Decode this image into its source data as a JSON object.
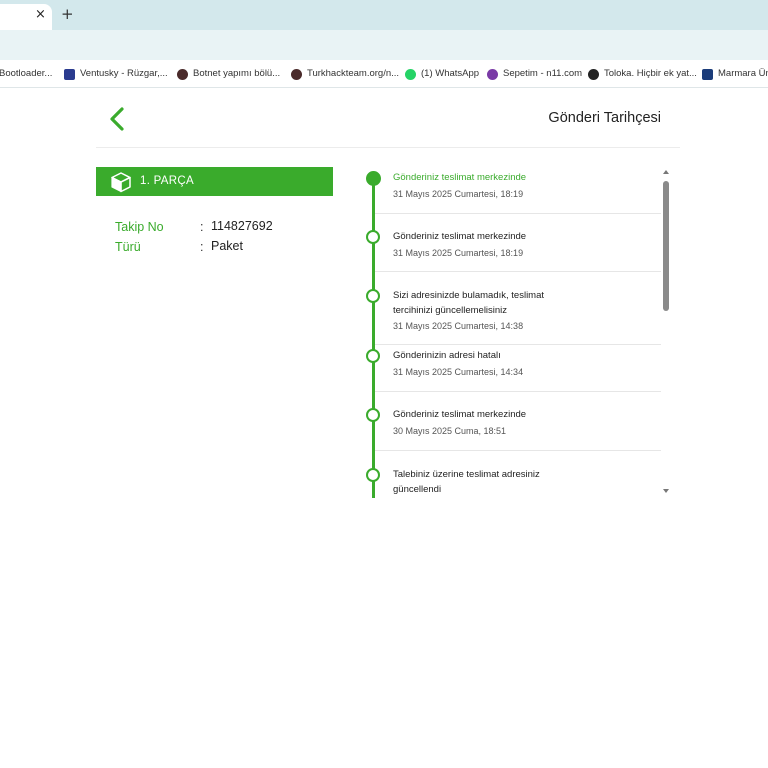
{
  "browser": {
    "close_tab": "×",
    "new_tab": "+",
    "bookmarks": [
      {
        "label": "Bootloader...",
        "icon": "bootloader-icon"
      },
      {
        "label": "Ventusky - Rüzgar,...",
        "icon": "ventusky-icon",
        "color": "#2a3b8f"
      },
      {
        "label": "Botnet yapımı bölü...",
        "icon": "turkhack-icon",
        "color": "#4a2a2a"
      },
      {
        "label": "Turkhackteam.org/n...",
        "icon": "turkhack-icon",
        "color": "#4a2a2a"
      },
      {
        "label": "(1) WhatsApp",
        "icon": "whatsapp-icon",
        "color": "#25d366"
      },
      {
        "label": "Sepetim - n11.com",
        "icon": "n11-icon",
        "color": "#7a3aa6"
      },
      {
        "label": "Toloka. Hiçbir ek yat...",
        "icon": "toloka-icon",
        "color": "#222222"
      },
      {
        "label": "Marmara Ün",
        "icon": "marmara-icon",
        "color": "#1b3c7a"
      }
    ]
  },
  "header": {
    "title": "Gönderi Tarihçesi"
  },
  "part": {
    "title": "1. PARÇA",
    "fields": [
      {
        "label": "Takip No",
        "colon": ":",
        "value": "114827692"
      },
      {
        "label": "Türü",
        "colon": ":",
        "value": "Paket"
      }
    ]
  },
  "timeline": [
    {
      "title": "Gönderiniz teslimat merkezinde",
      "date": "31 Mayıs 2025 Cumartesi, 18:19",
      "current": true
    },
    {
      "title": "Gönderiniz teslimat merkezinde",
      "date": "31 Mayıs 2025 Cumartesi, 18:19"
    },
    {
      "title": "Sizi adresinizde bulamadık, teslimat tercihinizi güncellemelisiniz",
      "date": "31 Mayıs 2025 Cumartesi, 14:38"
    },
    {
      "title": "Gönderinizin adresi hatalı",
      "date": "31 Mayıs 2025 Cumartesi, 14:34"
    },
    {
      "title": "Gönderiniz teslimat merkezinde",
      "date": "30 Mayıs 2025 Cuma, 18:51"
    },
    {
      "title": "Talebiniz üzerine teslimat adresiniz güncellendi",
      "date": ""
    }
  ],
  "colors": {
    "accent": "#3aab2c",
    "tabstrip": "#d3e8ec"
  }
}
